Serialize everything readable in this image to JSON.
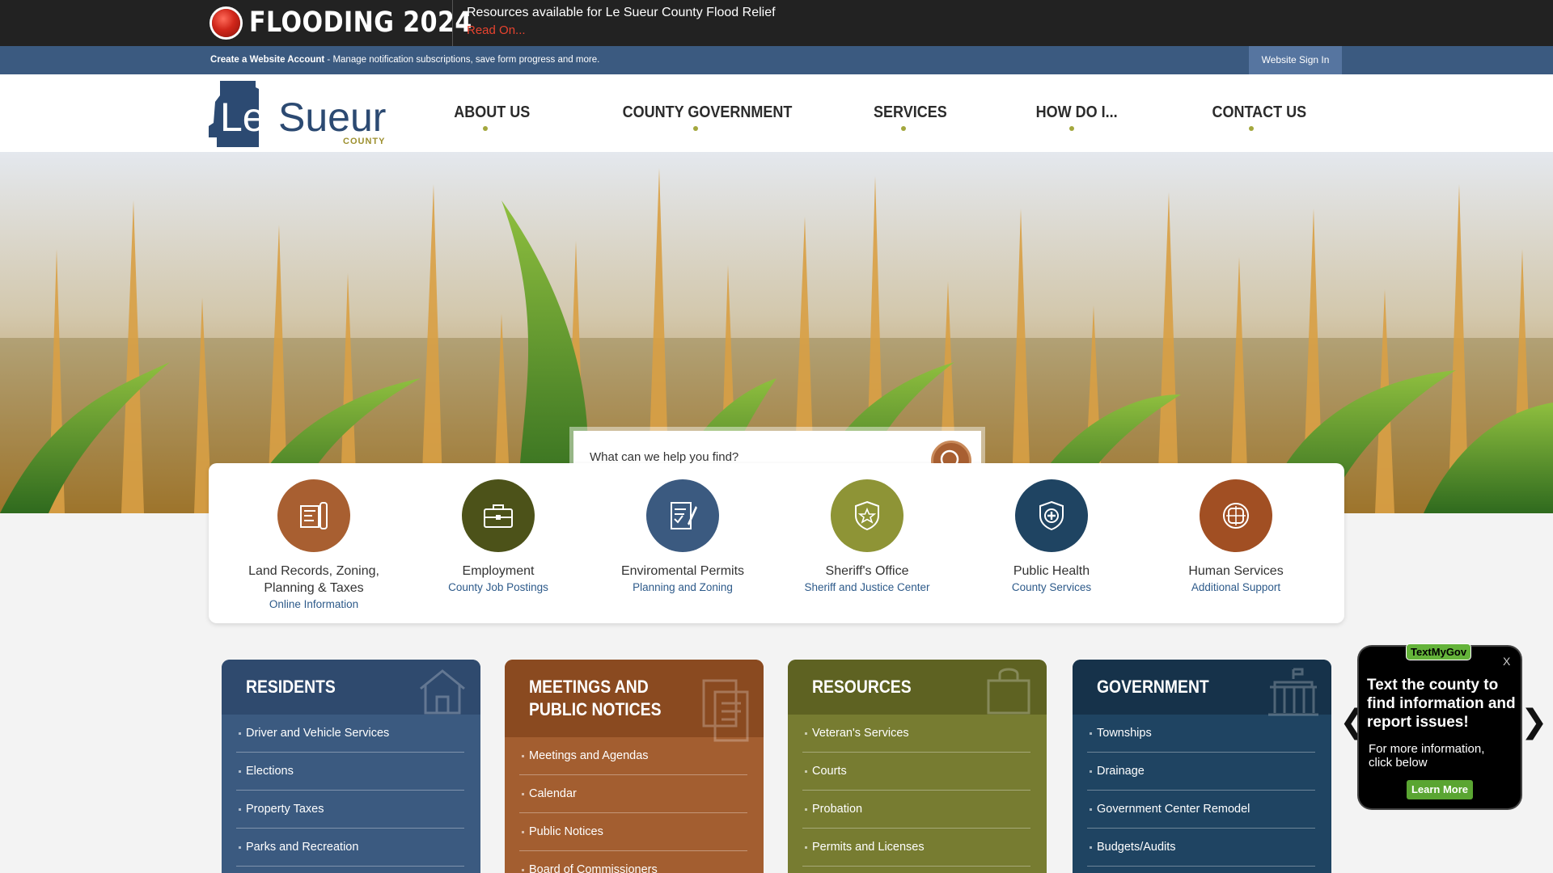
{
  "alert": {
    "title": "FLOODING 2024",
    "message": "Resources available for Le Sueur County Flood Relief",
    "link": "Read On..."
  },
  "account_bar": {
    "create_account": "Create a Website Account",
    "description": " - Manage notification subscriptions, save form progress and more.",
    "sign_in": "Website Sign In"
  },
  "logo": {
    "line1": "Le",
    "line2": "Sueur",
    "line3": "COUNTY"
  },
  "nav": [
    "ABOUT US",
    "COUNTY GOVERNMENT",
    "SERVICES",
    "HOW DO I...",
    "CONTACT US"
  ],
  "search": {
    "placeholder": "What can we help you find?"
  },
  "quick_links": [
    {
      "title": "Land Records, Zoning, Planning & Taxes",
      "sub": "Online Information",
      "color": "#a85f31",
      "icon": "map-icon"
    },
    {
      "title": "Employment",
      "sub": "County Job Postings",
      "color": "#4c5219",
      "icon": "briefcase-icon"
    },
    {
      "title": "Enviromental Permits",
      "sub": "Planning and Zoning",
      "color": "#3b5a80",
      "icon": "permit-document-icon"
    },
    {
      "title": "Sheriff's Office",
      "sub": "Sheriff and Justice Center",
      "color": "#8e9436",
      "icon": "badge-shield-icon"
    },
    {
      "title": "Public Health",
      "sub": "County Services",
      "color": "#1f4462",
      "icon": "health-shield-icon"
    },
    {
      "title": "Human Services",
      "sub": "Additional Support",
      "color": "#a14f23",
      "icon": "people-hands-icon"
    }
  ],
  "cards": [
    {
      "title": "RESIDENTS",
      "head_color": "#2f4a6e",
      "body_color": "#3b5a80",
      "items": [
        "Driver and Vehicle Services",
        "Elections",
        "Property Taxes",
        "Parks and Recreation"
      ]
    },
    {
      "title": "MEETINGS AND PUBLIC NOTICES",
      "head_color": "#8a4a20",
      "body_color": "#a35e30",
      "items": [
        "Meetings and Agendas",
        "Calendar",
        "Public Notices",
        "Board of Commissioners"
      ]
    },
    {
      "title": "RESOURCES",
      "head_color": "#5e6222",
      "body_color": "#777c31",
      "items": [
        "Veteran's Services",
        "Courts",
        "Probation",
        "Permits and Licenses"
      ]
    },
    {
      "title": "GOVERNMENT",
      "head_color": "#16324a",
      "body_color": "#1f4462",
      "items": [
        "Townships",
        "Drainage",
        "Government Center Remodel",
        "Budgets/Audits"
      ]
    }
  ],
  "textmygov": {
    "badge": "TextMyGov",
    "close": "X",
    "headline": "Text the county to find information and report issues!",
    "body": "For more information, click below",
    "button": "Learn More"
  },
  "carousel": {
    "prev": "❮",
    "next": "❯"
  }
}
